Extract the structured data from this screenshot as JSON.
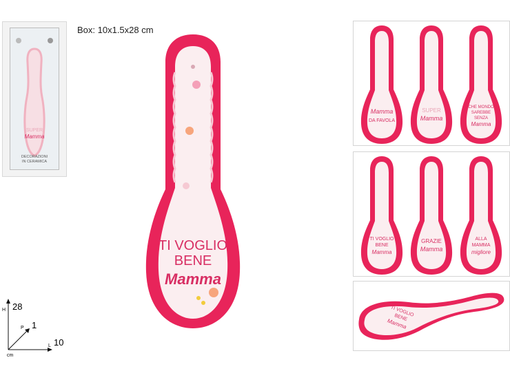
{
  "box_label": "Box: 10x1.5x28 cm",
  "package": {
    "line1": "DECORAZIONI",
    "line2": "IN CERAMICA",
    "front_text_1": "SUPER",
    "front_text_2": "Mamma"
  },
  "main_spoon": {
    "line1": "TI VOGLIO",
    "line2": "BENE",
    "line3": "Mamma"
  },
  "variants_row1": [
    {
      "line1": "Mamma",
      "line2": "DA FAVOLA",
      "line3": ""
    },
    {
      "line1": "SUPER",
      "line2": "Mamma",
      "line3": ""
    },
    {
      "line1": "CHE MONDO",
      "line2": "SAREBBE",
      "line3": "SENZA",
      "line4": "Mamma"
    }
  ],
  "variants_row2": [
    {
      "line1": "TI VOGLIO",
      "line2": "BENE",
      "line3": "Mamma"
    },
    {
      "line1": "GRAZIE",
      "line2": "Mamma",
      "line3": ""
    },
    {
      "line1": "ALLA",
      "line2": "MAMMA",
      "line3": "migliore"
    }
  ],
  "side_view": {
    "line1": "TI VOGLIO",
    "line2": "BENE",
    "line3": "Mamma"
  },
  "dimensions": {
    "height": "28",
    "height_axis": "H",
    "depth": "1",
    "depth_axis": "P",
    "length": "10",
    "length_axis": "L",
    "unit": "cm"
  },
  "colors": {
    "rim": "#e8245a",
    "body": "#fbeef0",
    "text": "#d82e63"
  }
}
